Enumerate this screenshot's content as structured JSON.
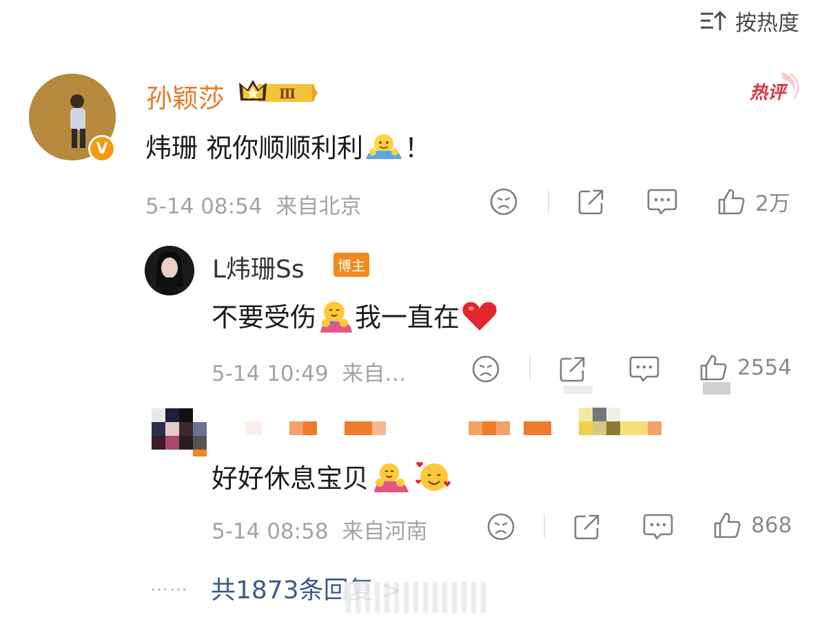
{
  "sort": {
    "label": "按热度"
  },
  "comments": [
    {
      "author": "孙颖莎",
      "level": "Ⅲ",
      "hot_tag": "热评",
      "text": "炜珊 祝你顺顺利利",
      "text_end": "！",
      "time": "5-14 08:54",
      "location": "来自北京",
      "likes": "2万"
    },
    {
      "author": "L炜珊Ss",
      "tag": "博主",
      "text_a": "不要受伤",
      "text_b": "我一直在",
      "time": "5-14 10:49",
      "location": "来自…",
      "likes": "2554"
    },
    {
      "text": "好好休息宝贝",
      "time": "5-14 08:58",
      "location": "来自河南",
      "likes": "868"
    }
  ],
  "more_replies": {
    "dots": "……",
    "label": "共1873条回复 >"
  },
  "colors": {
    "author": "#e9782b",
    "link": "#3b5a8c",
    "meta": "#a3a3a3",
    "tag": "#f08a1c",
    "verified": "#f29a12"
  }
}
